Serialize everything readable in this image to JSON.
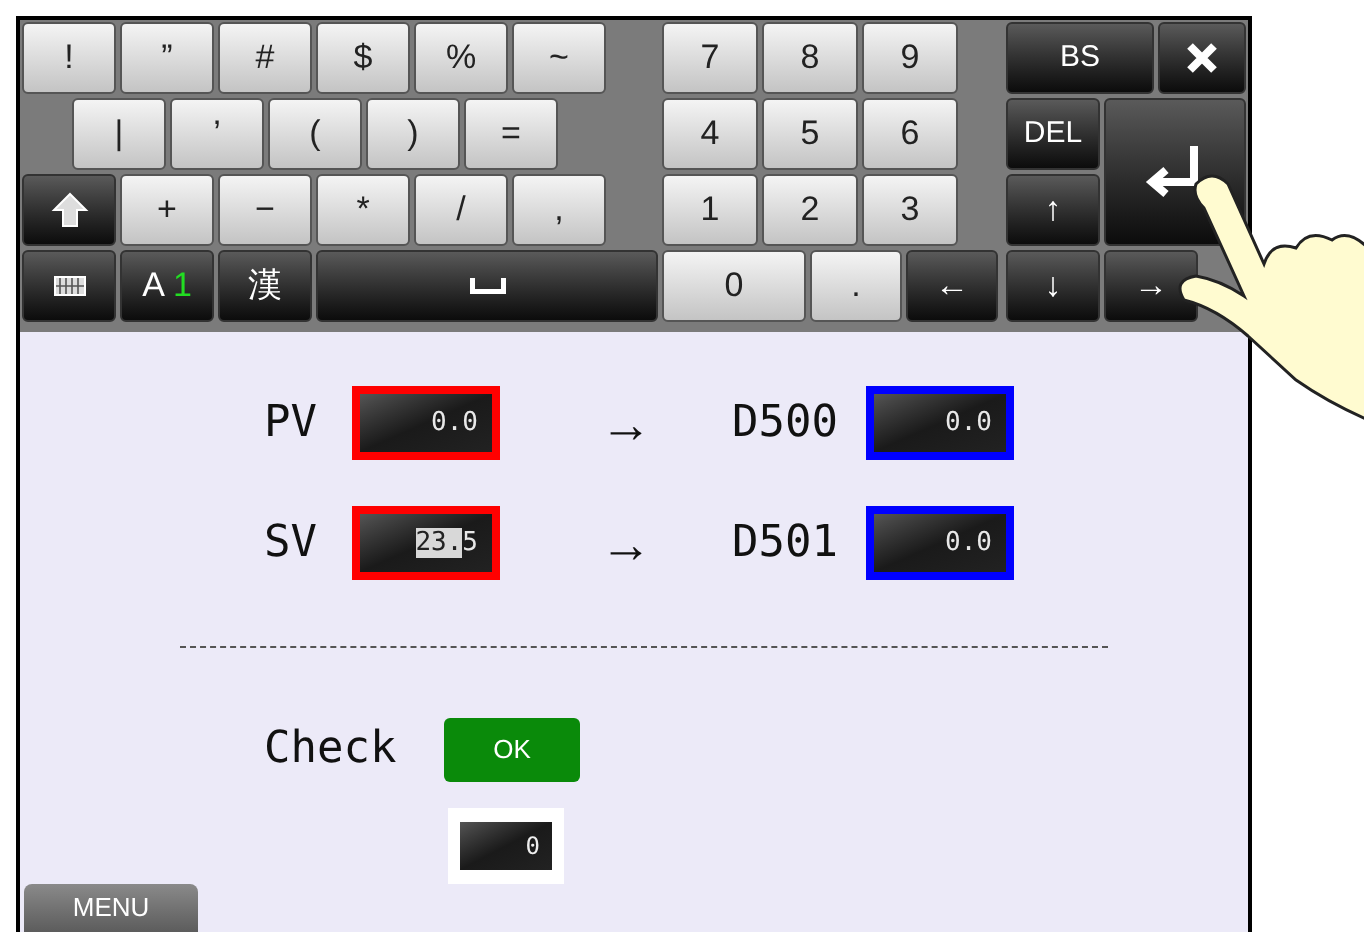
{
  "keyboard": {
    "left_rows": [
      [
        {
          "kind": "char",
          "label": "!"
        },
        {
          "kind": "char",
          "label": "”"
        },
        {
          "kind": "char",
          "label": "#"
        },
        {
          "kind": "char",
          "label": "$"
        },
        {
          "kind": "char",
          "label": "%"
        },
        {
          "kind": "char",
          "label": "~"
        }
      ],
      [
        {
          "kind": "char",
          "label": "|"
        },
        {
          "kind": "char",
          "label": "’"
        },
        {
          "kind": "char",
          "label": "("
        },
        {
          "kind": "char",
          "label": ")"
        },
        {
          "kind": "char",
          "label": "="
        }
      ],
      [
        {
          "kind": "shift"
        },
        {
          "kind": "char",
          "label": "+"
        },
        {
          "kind": "char",
          "label": "−"
        },
        {
          "kind": "char",
          "label": "*"
        },
        {
          "kind": "char",
          "label": "/"
        },
        {
          "kind": "char",
          "label": ","
        }
      ],
      [
        {
          "kind": "keyboard"
        },
        {
          "kind": "mode",
          "label": "A",
          "accent": "1"
        },
        {
          "kind": "dark",
          "label": "漢"
        },
        {
          "kind": "space"
        }
      ]
    ],
    "numpad_rows": [
      [
        {
          "kind": "char",
          "label": "7"
        },
        {
          "kind": "char",
          "label": "8"
        },
        {
          "kind": "char",
          "label": "9"
        }
      ],
      [
        {
          "kind": "char",
          "label": "4"
        },
        {
          "kind": "char",
          "label": "5"
        },
        {
          "kind": "char",
          "label": "6"
        }
      ],
      [
        {
          "kind": "char",
          "label": "1"
        },
        {
          "kind": "char",
          "label": "2"
        },
        {
          "kind": "char",
          "label": "3"
        }
      ],
      [
        {
          "kind": "wide",
          "label": "0"
        },
        {
          "kind": "char",
          "label": "."
        },
        {
          "kind": "dark",
          "label": "←"
        }
      ]
    ],
    "controls": {
      "backspace": "BS",
      "delete": "DEL",
      "up": "↑",
      "down": "↓",
      "right": "→"
    }
  },
  "rows": [
    {
      "label": "PV",
      "value_parts": [
        {
          "text": "0.0",
          "highlighted": false
        }
      ],
      "color": "#ff0000",
      "target": {
        "label": "D500",
        "value": "0.0",
        "color": "#0000ff"
      }
    },
    {
      "label": "SV",
      "value_parts": [
        {
          "text": "23.",
          "highlighted": true
        },
        {
          "text": "5",
          "highlighted": false
        }
      ],
      "color": "#ff0000",
      "target": {
        "label": "D501",
        "value": "0.0",
        "color": "#0000ff"
      }
    }
  ],
  "arrow": "→",
  "check": {
    "label": "Check",
    "button": "OK",
    "value": "0"
  },
  "menu_tab": "MENU"
}
